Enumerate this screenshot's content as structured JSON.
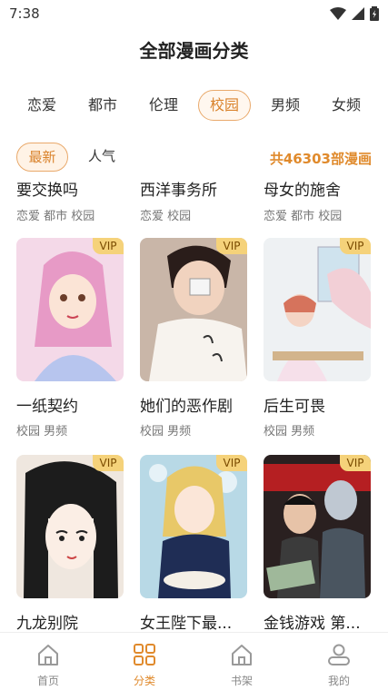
{
  "status_bar": {
    "time": "7:38"
  },
  "header": {
    "title": "全部漫画分类"
  },
  "tabs": [
    {
      "label": "恋爱",
      "active": false
    },
    {
      "label": "都市",
      "active": false
    },
    {
      "label": "伦理",
      "active": false
    },
    {
      "label": "校园",
      "active": true
    },
    {
      "label": "男频",
      "active": false
    },
    {
      "label": "女频",
      "active": false
    }
  ],
  "filter": {
    "latest": "最新",
    "popular": "人气",
    "total": "共46303部漫画"
  },
  "row0": [
    {
      "title": "要交换吗",
      "tags": "恋爱 都市 校园"
    },
    {
      "title": "西洋事务所",
      "tags": "恋爱 校园"
    },
    {
      "title": "母女的施舍",
      "tags": "恋爱 都市 校园"
    }
  ],
  "row1": [
    {
      "title": "一纸契约",
      "tags": "校园 男频",
      "vip": "VIP"
    },
    {
      "title": "她们的恶作剧",
      "tags": "校园 男频",
      "vip": "VIP"
    },
    {
      "title": "后生可畏",
      "tags": "校园 男频",
      "vip": "VIP"
    }
  ],
  "row2": [
    {
      "title": "九龙别院",
      "vip": "VIP"
    },
    {
      "title": "女王陛下最...",
      "vip": "VIP"
    },
    {
      "title": "金钱游戏 第...",
      "vip": "VIP"
    }
  ],
  "bottom_nav": [
    {
      "label": "首页",
      "active": false
    },
    {
      "label": "分类",
      "active": true
    },
    {
      "label": "书架",
      "active": false
    },
    {
      "label": "我的",
      "active": false
    }
  ],
  "colors": {
    "accent": "#e08a2c",
    "vip_bg": "#f5d27a"
  }
}
